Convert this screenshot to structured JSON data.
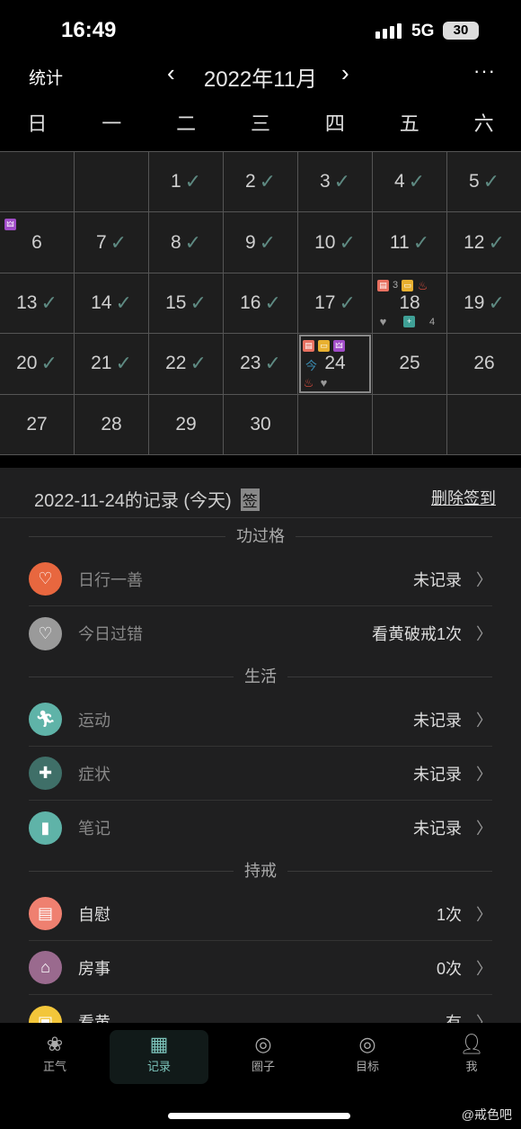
{
  "status": {
    "time": "16:49",
    "network": "5G",
    "battery": "30"
  },
  "header": {
    "left": "统计",
    "month": "2022年11月",
    "prev": "‹",
    "next": "›",
    "more": "···"
  },
  "weekdays": [
    "日",
    "一",
    "二",
    "三",
    "四",
    "五",
    "六"
  ],
  "calendar": [
    {
      "day": ""
    },
    {
      "day": ""
    },
    {
      "day": "1",
      "check": true
    },
    {
      "day": "2",
      "check": true
    },
    {
      "day": "3",
      "check": true
    },
    {
      "day": "4",
      "check": true
    },
    {
      "day": "5",
      "check": true
    },
    {
      "day": "6",
      "icons_top": [
        "pixel-figure"
      ]
    },
    {
      "day": "7",
      "check": true
    },
    {
      "day": "8",
      "check": true
    },
    {
      "day": "9",
      "check": true
    },
    {
      "day": "10",
      "check": true
    },
    {
      "day": "11",
      "check": true
    },
    {
      "day": "12",
      "check": true
    },
    {
      "day": "13",
      "check": true
    },
    {
      "day": "14",
      "check": true
    },
    {
      "day": "15",
      "check": true
    },
    {
      "day": "16",
      "check": true
    },
    {
      "day": "17",
      "check": true
    },
    {
      "day": "18",
      "icons_top": [
        "toilet-paper:3",
        "monitor",
        "fire"
      ],
      "icons_bottom": [
        "broken-heart",
        "medkit:4"
      ]
    },
    {
      "day": "19",
      "check": true
    },
    {
      "day": "20",
      "check": true
    },
    {
      "day": "21",
      "check": true
    },
    {
      "day": "22",
      "check": true
    },
    {
      "day": "23",
      "check": true
    },
    {
      "day": "24",
      "today": true,
      "today_mark": "今",
      "icons_top": [
        "toilet-paper",
        "monitor",
        "pixel-figure"
      ],
      "icons_bottom": [
        "fire",
        "broken-heart"
      ]
    },
    {
      "day": "25"
    },
    {
      "day": "26"
    },
    {
      "day": "27"
    },
    {
      "day": "28"
    },
    {
      "day": "29"
    },
    {
      "day": "30"
    },
    {
      "day": ""
    },
    {
      "day": ""
    },
    {
      "day": ""
    }
  ],
  "record": {
    "title": "2022-11-24的记录 (今天)",
    "sign_badge": "签",
    "delete": "删除签到"
  },
  "sections": [
    {
      "title": "功过格",
      "rows": [
        {
          "label": "日行一善",
          "value": "未记录",
          "icon": "heart-icon",
          "color": "#e8673f",
          "recorded": false
        },
        {
          "label": "今日过错",
          "value": "看黄破戒1次",
          "icon": "broken-heart-icon",
          "color": "#9a9a9a",
          "recorded": false
        }
      ]
    },
    {
      "title": "生活",
      "rows": [
        {
          "label": "运动",
          "value": "未记录",
          "icon": "running-icon",
          "color": "#5fb3a8",
          "recorded": false
        },
        {
          "label": "症状",
          "value": "未记录",
          "icon": "medkit-icon",
          "color": "#3f6f68",
          "recorded": false
        },
        {
          "label": "笔记",
          "value": "未记录",
          "icon": "notebook-icon",
          "color": "#5fb3a8",
          "recorded": false
        }
      ]
    },
    {
      "title": "持戒",
      "rows": [
        {
          "label": "自慰",
          "value": "1次",
          "icon": "toilet-paper-icon",
          "color": "#ef8070",
          "recorded": true
        },
        {
          "label": "房事",
          "value": "0次",
          "icon": "house-icon",
          "color": "#9a6a8e",
          "recorded": true
        },
        {
          "label": "看黄",
          "value": "有",
          "icon": "monitor-icon",
          "color": "#f3c63a",
          "recorded": true
        }
      ]
    }
  ],
  "nav": [
    {
      "label": "正气",
      "icon": "lotus-icon"
    },
    {
      "label": "记录",
      "icon": "calendar-icon",
      "active": true
    },
    {
      "label": "圈子",
      "icon": "circle-icon"
    },
    {
      "label": "目标",
      "icon": "target-icon"
    },
    {
      "label": "我",
      "icon": "user-icon"
    }
  ],
  "watermark": "@戒色吧",
  "colors": {
    "accent": "#7cc4bb",
    "check": "#5e8a82",
    "bg": "#1f1f20"
  }
}
